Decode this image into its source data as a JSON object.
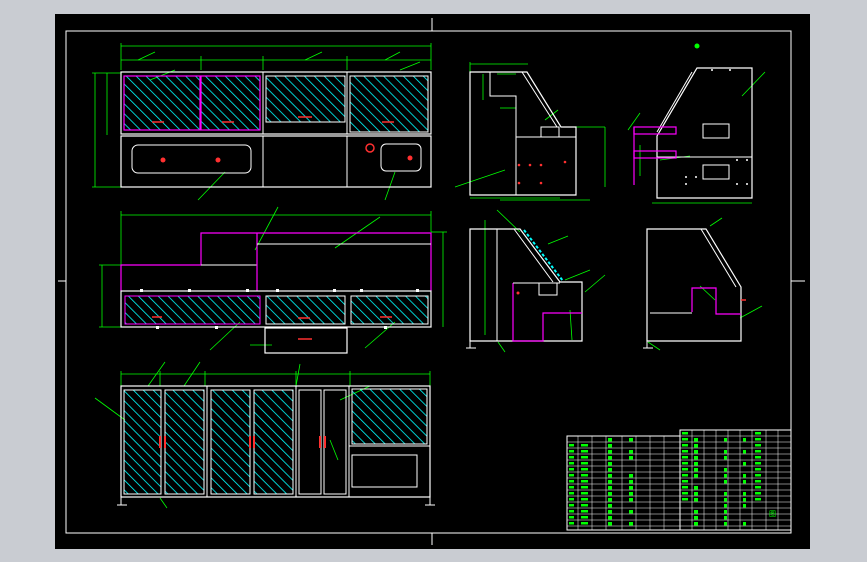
{
  "viewer": {
    "background": "#c9ccd2",
    "sheet_color": "#000000"
  },
  "colors": {
    "line": "#ffffff",
    "dimension": "#00ff00",
    "highlight": "#ff00ff",
    "hatch": "#00ffff",
    "accent": "#ff3030",
    "table_text": "#00ff00"
  },
  "title_block": {
    "mark": "图"
  }
}
